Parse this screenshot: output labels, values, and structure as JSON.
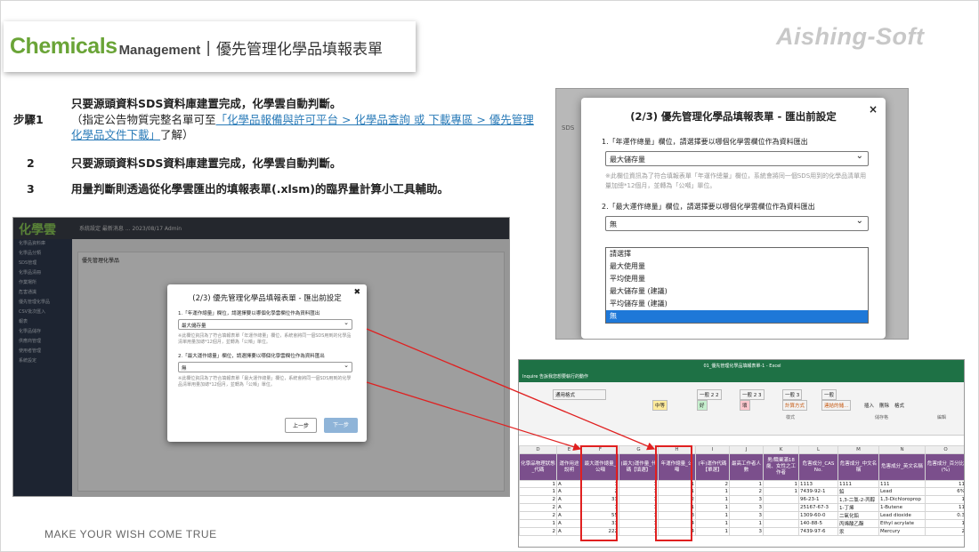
{
  "header": {
    "logo_chem": "Chemicals",
    "logo_man": "Management",
    "separator": "|",
    "title": "優先管理化學品填報表單",
    "brand": "Aishing-Soft"
  },
  "steps": [
    {
      "num": "步驟1",
      "line1": "只要源頭資料SDS資料庫建置完成，化學雲自動判斷。",
      "pre": "（指定公告物質完整名單可至",
      "link": "「化學品報備與許可平台 > 化學品查詢 或 下載專區 > 優先管理化學品文件下載」",
      "post": "了解）"
    },
    {
      "num": "2",
      "line1": "只要源頭資料SDS資料庫建置完成，化學雲自動判斷。"
    },
    {
      "num": "3",
      "line1": "用量判斷則透過從化學雲匯出的填報表單(.xlsm)的臨界量計算小工具輔助。"
    }
  ],
  "slogan": "MAKE YOUR WISH COME TRUE",
  "left_app": {
    "logo": "化學雲",
    "top_text": "系統設定  最新消息  ...  2023/08/17  Admin",
    "sidebar": [
      "化學品資料庫",
      "化學品分類",
      "SDS管理",
      "化學品清冊",
      "作業場所",
      "危害通識",
      "優先管理化學品",
      "CSV批次匯入",
      "報表",
      "化學品儲存",
      "供應商管理",
      "使用者管理",
      "系統設定"
    ],
    "card_title": "優先管理化學品",
    "dialog": {
      "title": "(2/3) 優先管理化學品填報表單 - 匯出前設定",
      "q1": "1.「年運作總量」欄位，請選擇要以哪個化學雲欄位作為資料匯出",
      "q1_value": "最大儲存量",
      "q1_note": "※此欄位資訊為了符合填報表單「年運作總量」欄位，系統會將同一個SDS用到的化學品清單用量加總*12個月，並轉為「公噸」單位。",
      "q2": "2.「最大運作總量」欄位，請選擇要以哪個化學雲欄位作為資料匯出",
      "q2_value": "無",
      "q2_note": "※此欄位資訊為了符合填報表單「最大運作總量」欄位，系統會將同一個SDS用到的化學品清單用量加總*12個月，並轉為「公噸」單位。",
      "prev": "上一步",
      "next": "下一步"
    }
  },
  "right_dialog": {
    "title": "(2/3) 優先管理化學品填報表單 - 匯出前設定",
    "q1": "1.「年運作總量」欄位，請選擇要以哪個化學雲欄位作為資料匯出",
    "q1_value": "最大儲存量",
    "q1_note": "※此欄位資訊為了符合填報表單「年運作總量」欄位，系統會將同一個SDS用到的化學品清單用量加總*12個月，並轉為「公噸」單位。",
    "q2": "2.「最大運作總量」欄位，請選擇要以哪個化學雲欄位作為資料匯出",
    "q2_value": "無",
    "options": [
      "請選擇",
      "最大使用量",
      "平均使用量",
      "最大儲存量 (建議)",
      "平均儲存量 (建議)",
      "無"
    ],
    "selected_option": "無",
    "bg_text": "SDS",
    "close": "×"
  },
  "excel": {
    "title": "01_優先管理化學品填報表單-1 - Excel",
    "tabs": "Inquire   告訴我您想要執行的動作",
    "ribbon": [
      "通用格式",
      "一般 2 2",
      "一般 2 3",
      "一般 3",
      "一般",
      "中等",
      "好",
      "壞",
      "計算方式",
      "連結的儲...",
      "插入",
      "刪除",
      "格式",
      "樣式",
      "儲存格",
      "編輯"
    ],
    "col_letters": [
      "D",
      "E",
      "F",
      "G",
      "H",
      "I",
      "J",
      "K",
      "L",
      "M",
      "N",
      "O"
    ],
    "headers": [
      "化學品物理狀態_代碼",
      "運作用途說明",
      "最大運作總量_公噸",
      "(最大)運作量_代碼【填選】",
      "年運作總量_公噸",
      "(年)運作代碼【單選】",
      "最高工作者人數",
      "男/職業滿18歲、女性之工作者",
      "危害成分_CAS No.",
      "危害成分_中文名稱",
      "危害成分_英文名稱",
      "危害成分_百分比(%)"
    ],
    "rows": [
      [
        "1",
        "A",
        "1",
        "1",
        "1",
        "2",
        "1",
        "1",
        "1113",
        "1111",
        "111",
        "11"
      ],
      [
        "1",
        "A",
        "2",
        "1",
        "1",
        "1",
        "2",
        "1",
        "7439-92-1",
        "鉛",
        "Lead",
        "6%"
      ],
      [
        "2",
        "A",
        "33",
        "1",
        "2",
        "1",
        "3",
        "",
        "96-23-1",
        "1,3-二氯-2-丙醇",
        "1,3-Dichloroprop",
        "1"
      ],
      [
        "2",
        "A",
        "1",
        "1",
        "1",
        "1",
        "3",
        "",
        "25167-67-3",
        "1-丁烯",
        "1-Butene",
        "11"
      ],
      [
        "2",
        "A",
        "55",
        "1",
        "3",
        "1",
        "3",
        "",
        "1309-60-0",
        "二氧化鉛",
        "Lead dioxide",
        "0.3"
      ],
      [
        "1",
        "A",
        "33",
        "1",
        "4",
        "1",
        "1",
        "",
        "140-88-5",
        "丙烯酸乙酯",
        "Ethyl acrylate",
        "1"
      ],
      [
        "2",
        "A",
        "222",
        "1",
        "4",
        "1",
        "3",
        "",
        "7439-97-6",
        "汞",
        "Mercury",
        "2"
      ]
    ]
  },
  "colors": {
    "brand_green": "#6aa437",
    "excel_green": "#1e7145",
    "header_purple": "#7b4f8c",
    "highlight": "#e02020",
    "select_blue": "#1e78d8"
  }
}
